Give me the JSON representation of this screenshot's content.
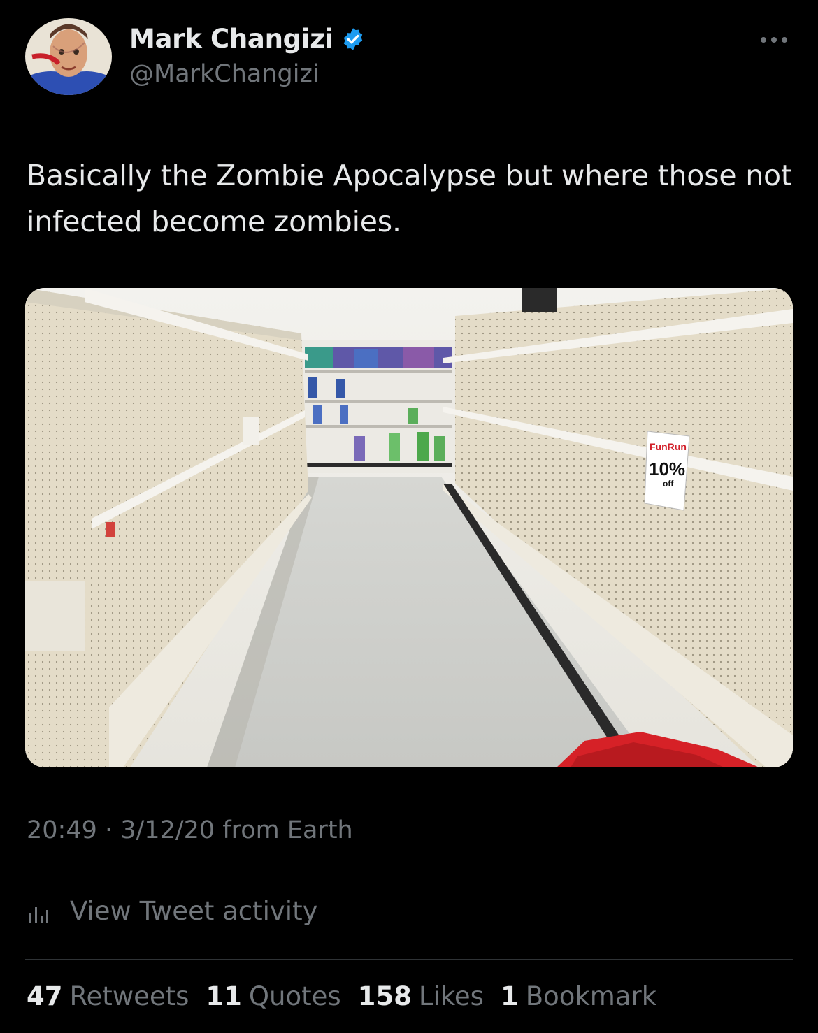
{
  "author": {
    "name": "Mark Changizi",
    "handle": "@MarkChangizi",
    "verified": true
  },
  "tweet": {
    "text": "Basically the Zombie Apocalypse but where those not infected become zombies.",
    "timestamp": "20:49 · 3/12/20 from Earth"
  },
  "photo": {
    "sign_brand": "FunRun",
    "sign_discount": "10%",
    "sign_off": "off"
  },
  "activity": {
    "label": "View Tweet activity",
    "icon": "bar-chart-icon"
  },
  "stats": [
    {
      "count": "47",
      "label": "Retweets"
    },
    {
      "count": "11",
      "label": "Quotes"
    },
    {
      "count": "158",
      "label": "Likes"
    },
    {
      "count": "1",
      "label": "Bookmark"
    }
  ],
  "colors": {
    "background": "#000000",
    "primary_text": "#e7e9ea",
    "secondary_text": "#71767b",
    "verified": "#1d9bf0",
    "divider": "#2f3336"
  }
}
